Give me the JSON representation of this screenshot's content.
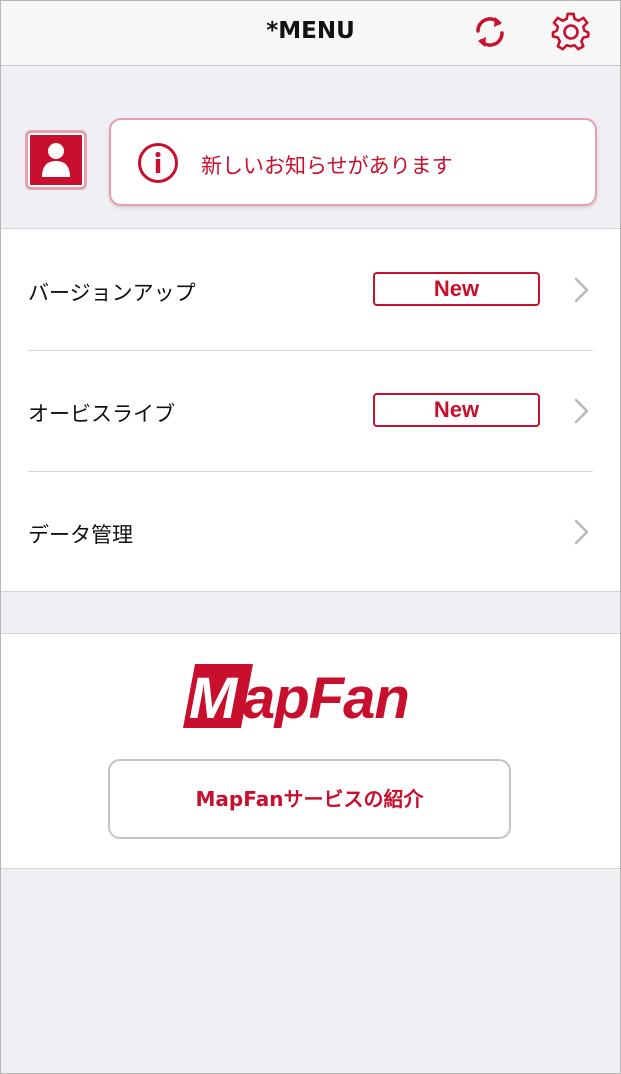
{
  "header": {
    "title": "*MENU",
    "sync_icon": "sync-icon",
    "settings_icon": "gear-icon"
  },
  "notice": {
    "avatar_icon": "user-icon",
    "info_icon": "info-icon",
    "text": "新しいお知らせがあります"
  },
  "menu": {
    "items": [
      {
        "label": "バージョンアップ",
        "badge": "New"
      },
      {
        "label": "オービスライブ",
        "badge": "New"
      },
      {
        "label": "データ管理",
        "badge": ""
      }
    ]
  },
  "promo": {
    "logo": "MapFan",
    "button_label": "MapFanサービスの紹介"
  },
  "colors": {
    "accent": "#c8102e",
    "background": "#efeff4",
    "header_bg": "#f7f7f7"
  }
}
